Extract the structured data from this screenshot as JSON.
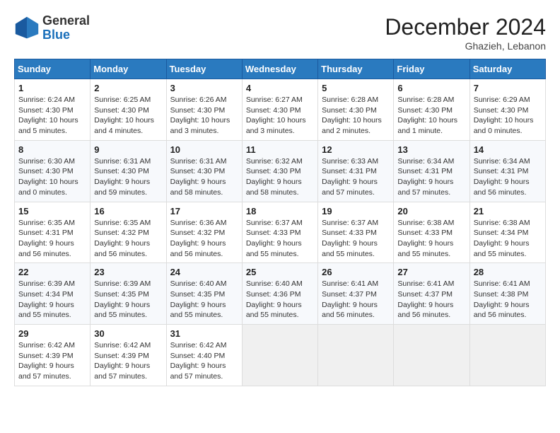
{
  "header": {
    "logo_general": "General",
    "logo_blue": "Blue",
    "month_title": "December 2024",
    "location": "Ghazieh, Lebanon"
  },
  "calendar": {
    "days_of_week": [
      "Sunday",
      "Monday",
      "Tuesday",
      "Wednesday",
      "Thursday",
      "Friday",
      "Saturday"
    ],
    "weeks": [
      [
        {
          "day": "1",
          "info": "Sunrise: 6:24 AM\nSunset: 4:30 PM\nDaylight: 10 hours\nand 5 minutes."
        },
        {
          "day": "2",
          "info": "Sunrise: 6:25 AM\nSunset: 4:30 PM\nDaylight: 10 hours\nand 4 minutes."
        },
        {
          "day": "3",
          "info": "Sunrise: 6:26 AM\nSunset: 4:30 PM\nDaylight: 10 hours\nand 3 minutes."
        },
        {
          "day": "4",
          "info": "Sunrise: 6:27 AM\nSunset: 4:30 PM\nDaylight: 10 hours\nand 3 minutes."
        },
        {
          "day": "5",
          "info": "Sunrise: 6:28 AM\nSunset: 4:30 PM\nDaylight: 10 hours\nand 2 minutes."
        },
        {
          "day": "6",
          "info": "Sunrise: 6:28 AM\nSunset: 4:30 PM\nDaylight: 10 hours\nand 1 minute."
        },
        {
          "day": "7",
          "info": "Sunrise: 6:29 AM\nSunset: 4:30 PM\nDaylight: 10 hours\nand 0 minutes."
        }
      ],
      [
        {
          "day": "8",
          "info": "Sunrise: 6:30 AM\nSunset: 4:30 PM\nDaylight: 10 hours\nand 0 minutes."
        },
        {
          "day": "9",
          "info": "Sunrise: 6:31 AM\nSunset: 4:30 PM\nDaylight: 9 hours\nand 59 minutes."
        },
        {
          "day": "10",
          "info": "Sunrise: 6:31 AM\nSunset: 4:30 PM\nDaylight: 9 hours\nand 58 minutes."
        },
        {
          "day": "11",
          "info": "Sunrise: 6:32 AM\nSunset: 4:30 PM\nDaylight: 9 hours\nand 58 minutes."
        },
        {
          "day": "12",
          "info": "Sunrise: 6:33 AM\nSunset: 4:31 PM\nDaylight: 9 hours\nand 57 minutes."
        },
        {
          "day": "13",
          "info": "Sunrise: 6:34 AM\nSunset: 4:31 PM\nDaylight: 9 hours\nand 57 minutes."
        },
        {
          "day": "14",
          "info": "Sunrise: 6:34 AM\nSunset: 4:31 PM\nDaylight: 9 hours\nand 56 minutes."
        }
      ],
      [
        {
          "day": "15",
          "info": "Sunrise: 6:35 AM\nSunset: 4:31 PM\nDaylight: 9 hours\nand 56 minutes."
        },
        {
          "day": "16",
          "info": "Sunrise: 6:35 AM\nSunset: 4:32 PM\nDaylight: 9 hours\nand 56 minutes."
        },
        {
          "day": "17",
          "info": "Sunrise: 6:36 AM\nSunset: 4:32 PM\nDaylight: 9 hours\nand 56 minutes."
        },
        {
          "day": "18",
          "info": "Sunrise: 6:37 AM\nSunset: 4:33 PM\nDaylight: 9 hours\nand 55 minutes."
        },
        {
          "day": "19",
          "info": "Sunrise: 6:37 AM\nSunset: 4:33 PM\nDaylight: 9 hours\nand 55 minutes."
        },
        {
          "day": "20",
          "info": "Sunrise: 6:38 AM\nSunset: 4:33 PM\nDaylight: 9 hours\nand 55 minutes."
        },
        {
          "day": "21",
          "info": "Sunrise: 6:38 AM\nSunset: 4:34 PM\nDaylight: 9 hours\nand 55 minutes."
        }
      ],
      [
        {
          "day": "22",
          "info": "Sunrise: 6:39 AM\nSunset: 4:34 PM\nDaylight: 9 hours\nand 55 minutes."
        },
        {
          "day": "23",
          "info": "Sunrise: 6:39 AM\nSunset: 4:35 PM\nDaylight: 9 hours\nand 55 minutes."
        },
        {
          "day": "24",
          "info": "Sunrise: 6:40 AM\nSunset: 4:35 PM\nDaylight: 9 hours\nand 55 minutes."
        },
        {
          "day": "25",
          "info": "Sunrise: 6:40 AM\nSunset: 4:36 PM\nDaylight: 9 hours\nand 55 minutes."
        },
        {
          "day": "26",
          "info": "Sunrise: 6:41 AM\nSunset: 4:37 PM\nDaylight: 9 hours\nand 56 minutes."
        },
        {
          "day": "27",
          "info": "Sunrise: 6:41 AM\nSunset: 4:37 PM\nDaylight: 9 hours\nand 56 minutes."
        },
        {
          "day": "28",
          "info": "Sunrise: 6:41 AM\nSunset: 4:38 PM\nDaylight: 9 hours\nand 56 minutes."
        }
      ],
      [
        {
          "day": "29",
          "info": "Sunrise: 6:42 AM\nSunset: 4:39 PM\nDaylight: 9 hours\nand 57 minutes."
        },
        {
          "day": "30",
          "info": "Sunrise: 6:42 AM\nSunset: 4:39 PM\nDaylight: 9 hours\nand 57 minutes."
        },
        {
          "day": "31",
          "info": "Sunrise: 6:42 AM\nSunset: 4:40 PM\nDaylight: 9 hours\nand 57 minutes."
        },
        {
          "day": "",
          "info": ""
        },
        {
          "day": "",
          "info": ""
        },
        {
          "day": "",
          "info": ""
        },
        {
          "day": "",
          "info": ""
        }
      ]
    ]
  }
}
